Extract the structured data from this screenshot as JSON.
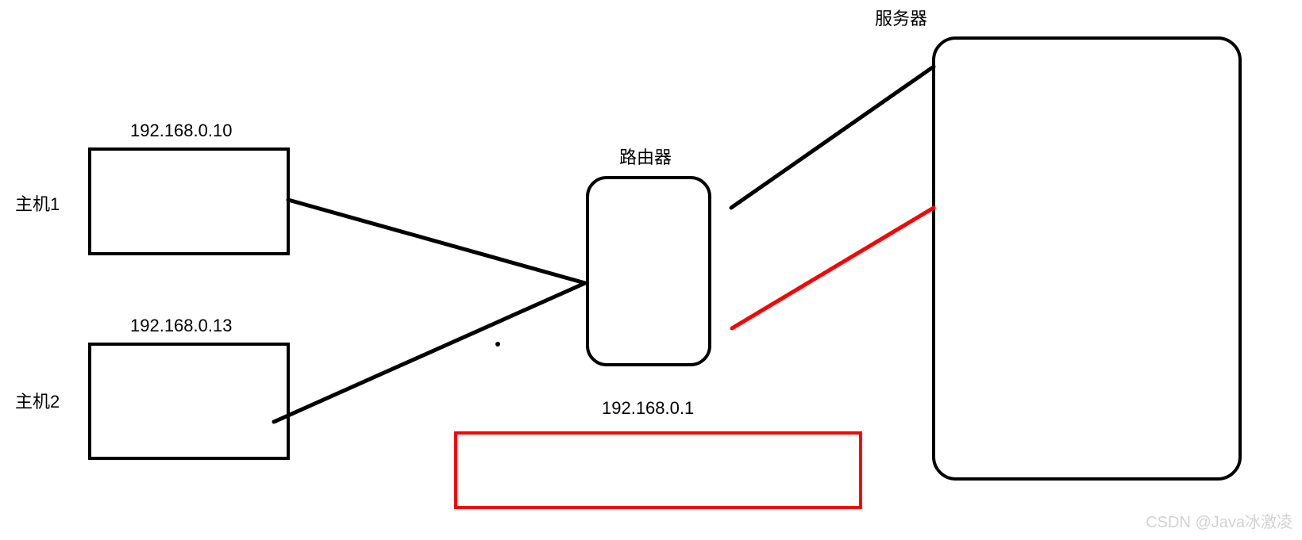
{
  "hosts": {
    "host1": {
      "label": "主机1",
      "ip": "192.168.0.10"
    },
    "host2": {
      "label": "主机2",
      "ip": "192.168.0.13"
    }
  },
  "router": {
    "label": "路由器",
    "ip": "192.168.0.1"
  },
  "server": {
    "label": "服务器"
  },
  "watermark": "CSDN @Java冰激凌",
  "colors": {
    "stroke": "#000000",
    "accent": "#ff0000"
  }
}
